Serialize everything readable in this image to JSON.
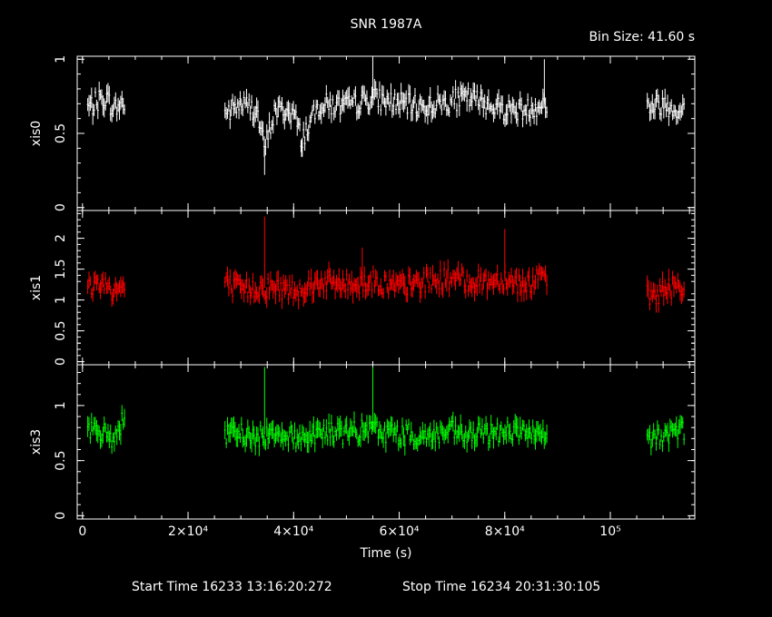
{
  "chart_data": {
    "type": "line",
    "title": "SNR 1987A",
    "bin_size_label": "Bin Size: 41.60 s",
    "xlabel": "Time (s)",
    "xlim": [
      -1000,
      116000
    ],
    "x_ticks": [
      {
        "value": 0,
        "label": "0"
      },
      {
        "value": 20000,
        "label": "2×10⁴"
      },
      {
        "value": 40000,
        "label": "4×10⁴"
      },
      {
        "value": 60000,
        "label": "6×10⁴"
      },
      {
        "value": 80000,
        "label": "8×10⁴"
      },
      {
        "value": 100000,
        "label": "10⁵"
      }
    ],
    "footer": {
      "start": "Start Time 16233 13:16:20:272",
      "stop": "Stop Time 16234 20:31:30:105"
    },
    "segments": [
      [
        1000,
        8000
      ],
      [
        27000,
        88000
      ],
      [
        107000,
        114000
      ]
    ],
    "panels": [
      {
        "ylabel": "xis0",
        "color": "#ffffff",
        "ylim": [
          -0.02,
          1.02
        ],
        "y_ticks": [
          {
            "value": 0,
            "label": "0"
          },
          {
            "value": 0.5,
            "label": "0.5"
          },
          {
            "value": 1,
            "label": "1"
          }
        ],
        "points": [
          [
            1500,
            0.68
          ],
          [
            3000,
            0.72
          ],
          [
            4500,
            0.74
          ],
          [
            6000,
            0.66
          ],
          [
            7500,
            0.7
          ],
          [
            27500,
            0.64
          ],
          [
            30000,
            0.7
          ],
          [
            33000,
            0.66
          ],
          [
            34500,
            0.4
          ],
          [
            36500,
            0.66
          ],
          [
            40000,
            0.64
          ],
          [
            41500,
            0.46
          ],
          [
            45000,
            0.7
          ],
          [
            50000,
            0.68
          ],
          [
            55000,
            0.74
          ],
          [
            60000,
            0.7
          ],
          [
            65000,
            0.68
          ],
          [
            70000,
            0.72
          ],
          [
            73000,
            0.74
          ],
          [
            77000,
            0.7
          ],
          [
            80000,
            0.66
          ],
          [
            84000,
            0.66
          ],
          [
            87000,
            0.7
          ],
          [
            107500,
            0.68
          ],
          [
            110000,
            0.7
          ],
          [
            113000,
            0.66
          ]
        ],
        "spikes": [
          [
            34500,
            0.22
          ],
          [
            41500,
            0.34
          ],
          [
            55000,
            1.0
          ],
          [
            87500,
            1.0
          ]
        ]
      },
      {
        "ylabel": "xis1",
        "color": "#ff0000",
        "ylim": [
          -0.05,
          2.45
        ],
        "y_ticks": [
          {
            "value": 0,
            "label": "0"
          },
          {
            "value": 0.5,
            "label": "0.5"
          },
          {
            "value": 1,
            "label": "1"
          },
          {
            "value": 1.5,
            "label": "1.5"
          },
          {
            "value": 2,
            "label": "2"
          }
        ],
        "points": [
          [
            1500,
            1.2
          ],
          [
            3000,
            1.3
          ],
          [
            4500,
            1.25
          ],
          [
            6000,
            1.15
          ],
          [
            7500,
            1.2
          ],
          [
            27500,
            1.25
          ],
          [
            30000,
            1.15
          ],
          [
            33000,
            1.2
          ],
          [
            36500,
            1.2
          ],
          [
            40000,
            1.15
          ],
          [
            45000,
            1.3
          ],
          [
            50000,
            1.25
          ],
          [
            55000,
            1.3
          ],
          [
            60000,
            1.2
          ],
          [
            65000,
            1.3
          ],
          [
            70000,
            1.35
          ],
          [
            73000,
            1.3
          ],
          [
            77000,
            1.3
          ],
          [
            80000,
            1.35
          ],
          [
            84000,
            1.25
          ],
          [
            87000,
            1.35
          ],
          [
            107500,
            1.05
          ],
          [
            110000,
            1.15
          ],
          [
            113000,
            1.25
          ]
        ],
        "spikes": [
          [
            34500,
            2.35
          ],
          [
            53000,
            1.85
          ],
          [
            80000,
            2.15
          ]
        ]
      },
      {
        "ylabel": "xis3",
        "color": "#00ff00",
        "ylim": [
          -0.03,
          1.37
        ],
        "y_ticks": [
          {
            "value": 0,
            "label": "0"
          },
          {
            "value": 0.5,
            "label": "0.5"
          },
          {
            "value": 1,
            "label": "1"
          }
        ],
        "points": [
          [
            1500,
            0.78
          ],
          [
            3000,
            0.72
          ],
          [
            4500,
            0.75
          ],
          [
            6000,
            0.7
          ],
          [
            7500,
            0.85
          ],
          [
            27500,
            0.72
          ],
          [
            30000,
            0.75
          ],
          [
            33000,
            0.7
          ],
          [
            36500,
            0.78
          ],
          [
            40000,
            0.7
          ],
          [
            45000,
            0.76
          ],
          [
            50000,
            0.75
          ],
          [
            55000,
            0.78
          ],
          [
            60000,
            0.74
          ],
          [
            65000,
            0.72
          ],
          [
            70000,
            0.76
          ],
          [
            73000,
            0.72
          ],
          [
            77000,
            0.75
          ],
          [
            80000,
            0.78
          ],
          [
            84000,
            0.75
          ],
          [
            87000,
            0.7
          ],
          [
            107500,
            0.7
          ],
          [
            110000,
            0.72
          ],
          [
            113000,
            0.78
          ]
        ],
        "spikes": [
          [
            34500,
            1.35
          ],
          [
            55000,
            1.35
          ]
        ]
      }
    ]
  }
}
